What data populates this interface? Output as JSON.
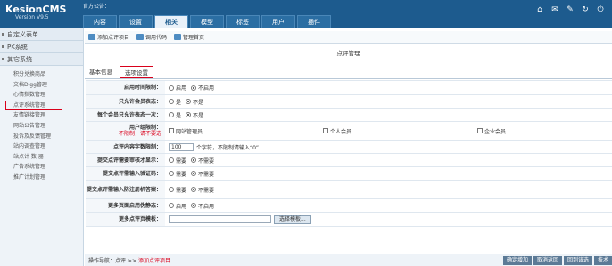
{
  "header": {
    "logo": "KesionCMS",
    "version": "Version V9.5",
    "notice": "官方公告：",
    "tabs": [
      "内容",
      "设置",
      "相关",
      "模型",
      "标签",
      "用户",
      "插件"
    ]
  },
  "sidebar": {
    "groups": [
      "自定义表单",
      "PK系统",
      "其它系统"
    ],
    "items": [
      "积分兑换商品",
      "文档Digg管理",
      "心情指数管理",
      "点评系统管理",
      "友情链接管理",
      "网站公告管理",
      "投诉及反馈管理",
      "站内调查管理",
      "站点计 数 器",
      "广告系统管理",
      "推广计划管理"
    ]
  },
  "toolbar": {
    "add": "添加点评项目",
    "code": "调用代码",
    "home": "管理首页"
  },
  "page_title": "点评管理",
  "subtabs": {
    "basic": "基本信息",
    "options": "选项设置"
  },
  "form": {
    "r1": {
      "label": "启用时间限制：",
      "opts": [
        "启用",
        "不启用"
      ]
    },
    "r2": {
      "label": "只允许会员表态：",
      "opts": [
        "是",
        "不是"
      ]
    },
    "r3": {
      "label": "每个会员只允许表态一次：",
      "opts": [
        "是",
        "不是"
      ]
    },
    "r4": {
      "label": "用户组限制：",
      "note": "不限制，请不要选",
      "groups": [
        "网站管理员",
        "个人会员",
        "企业会员"
      ]
    },
    "r5": {
      "label": "点评内容字数限制：",
      "value": "100",
      "hint": "个字符，不限制请输入“0”"
    },
    "r6": {
      "label": "提交点评需要审核才显示：",
      "opts": [
        "需要",
        "不需要"
      ]
    },
    "r7": {
      "label": "提交点评需输入验证码：",
      "opts": [
        "需要",
        "不需要"
      ]
    },
    "r8": {
      "label": "提交点评需输入防注册机答案：",
      "opts": [
        "需要",
        "不需要"
      ]
    },
    "r9": {
      "label": "更多页面启用伪静态：",
      "opts": [
        "启用",
        "不启用"
      ]
    },
    "r10": {
      "label": "更多点评页模板：",
      "button": "选择模板..."
    }
  },
  "footer": {
    "nav": "操作导航：",
    "path": "点评 >> ",
    "current": "添加点评项目",
    "buttons": [
      "确定增加",
      "取消返回",
      "回到该选",
      "技术"
    ]
  }
}
